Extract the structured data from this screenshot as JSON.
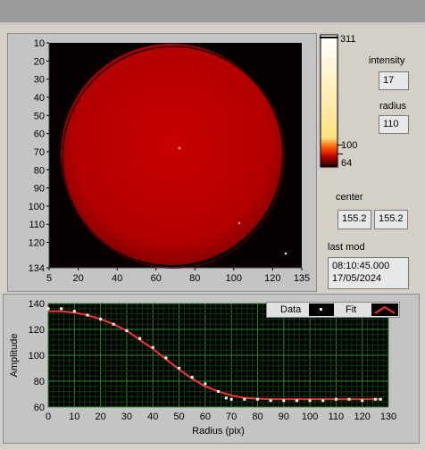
{
  "window": {
    "title_bar": ""
  },
  "image_view": {
    "y_ticks": [
      "10",
      "20",
      "30",
      "40",
      "50",
      "60",
      "70",
      "80",
      "90",
      "100",
      "110",
      "120",
      "134"
    ],
    "x_ticks": [
      "5",
      "20",
      "40",
      "60",
      "80",
      "100",
      "120",
      "135"
    ],
    "colors": {
      "disk": "#b80000",
      "background": "#060000"
    }
  },
  "colorbar": {
    "labels": [
      "311",
      "100",
      "64"
    ],
    "colors": [
      "#ffffff",
      "#ffe080",
      "#ff6000",
      "#c00000",
      "#200000"
    ]
  },
  "readouts": {
    "intensity_label": "intensity",
    "intensity_value": "17",
    "radius_label": "radius",
    "radius_value": "110",
    "center_label": "center",
    "center_x": "155.2",
    "center_y": "155.2",
    "last_mod_label": "last mod",
    "last_mod_time": "08:10:45.000",
    "last_mod_date": "17/05/2024"
  },
  "legend": {
    "data_label": "Data",
    "fit_label": "Fit"
  },
  "chart_data": {
    "type": "scatter",
    "xlabel": "Radius (pix)",
    "ylabel": "Amplitude",
    "xlim": [
      0,
      130
    ],
    "ylim": [
      60,
      140
    ],
    "x_ticks": [
      0,
      10,
      20,
      30,
      40,
      50,
      60,
      70,
      80,
      90,
      100,
      110,
      120,
      130
    ],
    "y_ticks": [
      60,
      80,
      100,
      120,
      140
    ],
    "grid": true,
    "legend_position": "top-right",
    "series": [
      {
        "name": "Data",
        "color": "#ffffff",
        "x": [
          0,
          5,
          10,
          15,
          20,
          25,
          30,
          35,
          40,
          45,
          50,
          55,
          60,
          65,
          68,
          70,
          75,
          80,
          85,
          90,
          95,
          100,
          105,
          110,
          115,
          120,
          125,
          127
        ],
        "y": [
          136,
          136,
          134,
          131,
          128,
          124,
          119,
          113,
          106,
          98,
          90,
          83,
          78,
          72,
          67,
          66,
          66,
          66,
          65,
          65,
          65,
          65,
          65,
          66,
          66,
          65,
          66,
          66
        ]
      },
      {
        "name": "Fit",
        "color": "#ff3030",
        "x": [
          0,
          5,
          10,
          15,
          20,
          25,
          30,
          35,
          40,
          45,
          50,
          55,
          60,
          65,
          70,
          75,
          80,
          85,
          90,
          100,
          110,
          120,
          127
        ],
        "y": [
          134,
          134,
          133,
          131,
          128,
          124,
          119,
          112,
          105,
          97,
          89,
          82,
          76,
          72,
          69,
          67,
          66.5,
          66,
          66,
          66,
          66,
          66,
          66
        ]
      }
    ]
  }
}
